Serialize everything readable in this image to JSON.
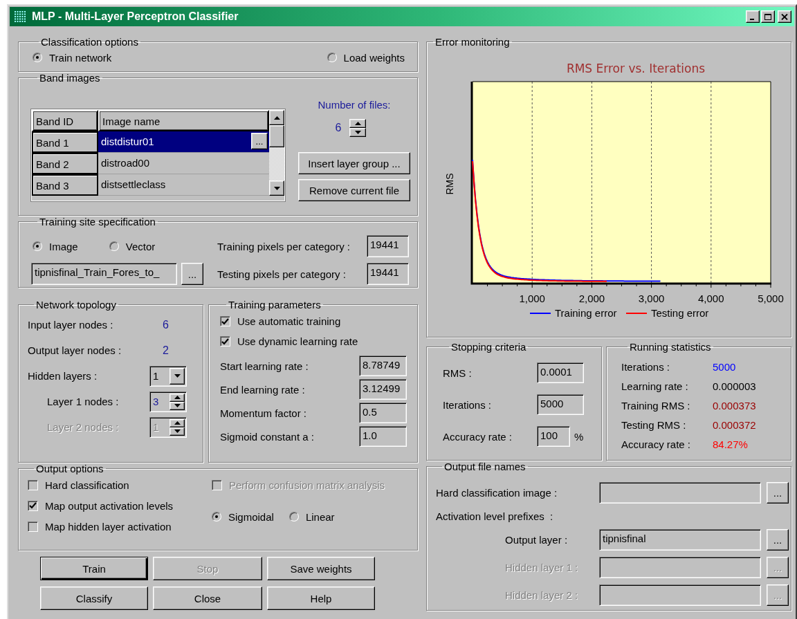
{
  "window": {
    "title": "MLP - Multi-Layer Perceptron Classifier"
  },
  "classification_options": {
    "title": "Classification options",
    "options": [
      {
        "label": "Train network",
        "selected": true
      },
      {
        "label": "Load weights",
        "selected": false
      }
    ]
  },
  "band_images": {
    "title": "Band images",
    "columns": [
      "Band ID",
      "Image name"
    ],
    "rows": [
      {
        "band_id": "Band 1",
        "image_name": "distdistur01",
        "selected": true,
        "browse": "..."
      },
      {
        "band_id": "Band 2",
        "image_name": "distroad00",
        "selected": false
      },
      {
        "band_id": "Band 3",
        "image_name": "distsettleclass",
        "selected": false
      }
    ],
    "number_of_files_label": "Number of files:",
    "number_of_files": "6",
    "buttons": [
      "Insert layer group ...",
      "Remove current file"
    ]
  },
  "training_site": {
    "title": "Training site specification",
    "source": [
      {
        "label": "Image",
        "selected": true
      },
      {
        "label": "Vector",
        "selected": false
      }
    ],
    "file": "tipnisfinal_Train_Fores_to_",
    "browse": "...",
    "fields": [
      {
        "label": "Training pixels per category :",
        "value": "19441"
      },
      {
        "label": "Testing pixels per category :",
        "value": "19441"
      }
    ]
  },
  "network_topology": {
    "title": "Network topology",
    "items": [
      {
        "kind": "value",
        "label": "Input layer nodes :",
        "value": "6",
        "disabled": false
      },
      {
        "kind": "value",
        "label": "Output layer nodes :",
        "value": "2",
        "disabled": false
      },
      {
        "kind": "dropdown",
        "label": "Hidden layers :",
        "value": "1",
        "disabled": false
      },
      {
        "kind": "spinner",
        "label": "Layer 1 nodes :",
        "value": "3",
        "disabled": false
      },
      {
        "kind": "spinner",
        "label": "Layer 2 nodes :",
        "value": "1",
        "disabled": true
      }
    ]
  },
  "training_parameters": {
    "title": "Training parameters",
    "checkboxes": [
      {
        "label": "Use automatic training",
        "checked": true
      },
      {
        "label": "Use dynamic learning rate",
        "checked": true
      }
    ],
    "fields": [
      {
        "label": "Start learning rate :",
        "value": "8.78749"
      },
      {
        "label": "End learning rate :",
        "value": "3.12499"
      },
      {
        "label": "Momentum factor :",
        "value": "0.5"
      },
      {
        "label": "Sigmoid constant a :",
        "value": "1.0"
      }
    ]
  },
  "output_options": {
    "title": "Output options",
    "checkboxes": [
      {
        "label": "Hard classification",
        "checked": false
      },
      {
        "label": "Map output activation levels",
        "checked": true
      },
      {
        "label": "Map hidden layer activation",
        "checked": false
      }
    ],
    "confusion_matrix": {
      "label": "Perform confusion matrix analysis",
      "checked": false,
      "disabled": true
    },
    "activation_function": [
      {
        "label": "Sigmoidal",
        "selected": true
      },
      {
        "label": "Linear",
        "selected": false
      }
    ]
  },
  "buttons": [
    {
      "label": "Train",
      "default": true,
      "disabled": false
    },
    {
      "label": "Stop",
      "default": false,
      "disabled": true
    },
    {
      "label": "Save weights",
      "default": false,
      "disabled": false
    },
    {
      "label": "Classify",
      "default": false,
      "disabled": false
    },
    {
      "label": "Close",
      "default": false,
      "disabled": false
    },
    {
      "label": "Help",
      "default": false,
      "disabled": false
    }
  ],
  "error_monitoring": {
    "title": "Error monitoring",
    "chart": {
      "title": "RMS Error vs. Iterations",
      "ylabel": "RMS",
      "xticks": [
        "1,000",
        "2,000",
        "3,000",
        "4,000",
        "5,000"
      ],
      "series": [
        {
          "name": "Training error",
          "color": "#0000ff"
        },
        {
          "name": "Testing error",
          "color": "#ff0000"
        }
      ]
    }
  },
  "stopping_criteria": {
    "title": "Stopping criteria",
    "fields": [
      {
        "label": "RMS :",
        "value": "0.0001"
      },
      {
        "label": "Iterations :",
        "value": "5000"
      },
      {
        "label": "Accuracy rate :",
        "value": "100",
        "unit": "%"
      }
    ]
  },
  "running_statistics": {
    "title": "Running statistics",
    "items": [
      {
        "label": "Iterations :",
        "value": "5000",
        "color": "#0000ff"
      },
      {
        "label": "Learning rate :",
        "value": "0.000003",
        "color": "#000000"
      },
      {
        "label": "Training RMS :",
        "value": "0.000373",
        "color": "#990000"
      },
      {
        "label": "Testing RMS :",
        "value": "0.000372",
        "color": "#990000"
      },
      {
        "label": "Accuracy rate :",
        "value": "84.27%",
        "color": "#ff0000"
      }
    ]
  },
  "output_file_names": {
    "title": "Output file names",
    "rows": [
      {
        "kind": "field",
        "label": "Hard classification image :",
        "browse": "...",
        "disabled": false
      },
      {
        "kind": "heading",
        "label": "Activation level prefixes  :",
        "children": [
          {
            "kind": "field",
            "label": "Output layer :",
            "value": "tipnisfinal",
            "browse": "...",
            "disabled": false
          },
          {
            "kind": "field",
            "label": "Hidden layer 1 :",
            "browse": "...",
            "disabled": true
          },
          {
            "kind": "field",
            "label": "Hidden layer 2 :",
            "browse": "...",
            "disabled": true
          }
        ]
      }
    ]
  }
}
